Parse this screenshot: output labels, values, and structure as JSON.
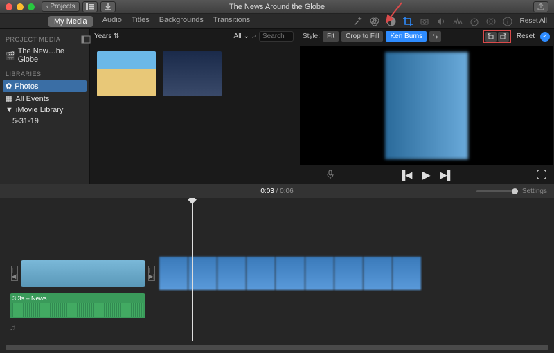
{
  "titlebar": {
    "projects_label": "Projects",
    "title": "The News Around the Globe"
  },
  "tabs": {
    "items": [
      "My Media",
      "Audio",
      "Titles",
      "Backgrounds",
      "Transitions"
    ],
    "active": 0,
    "reset_all": "Reset All"
  },
  "sidebar": {
    "project_media_hdr": "PROJECT MEDIA",
    "project_item": "The New…he Globe",
    "libraries_hdr": "LIBRARIES",
    "items": [
      {
        "icon": "photos",
        "label": "Photos",
        "selected": true
      },
      {
        "icon": "calendar",
        "label": "All Events"
      },
      {
        "icon": "disclosure",
        "label": "iMovie Library"
      },
      {
        "icon": "",
        "label": "5-31-19",
        "sub": true
      }
    ]
  },
  "browser": {
    "years_dd": "Years",
    "all_dd": "All",
    "search_placeholder": "Search"
  },
  "viewer": {
    "style_label": "Style:",
    "fit": "Fit",
    "crop": "Crop to Fill",
    "kenburns": "Ken Burns",
    "reset": "Reset"
  },
  "timeline": {
    "time_current": "0:03",
    "time_total": "0:06",
    "settings": "Settings",
    "audio_clip_label": "3.3s – News"
  }
}
